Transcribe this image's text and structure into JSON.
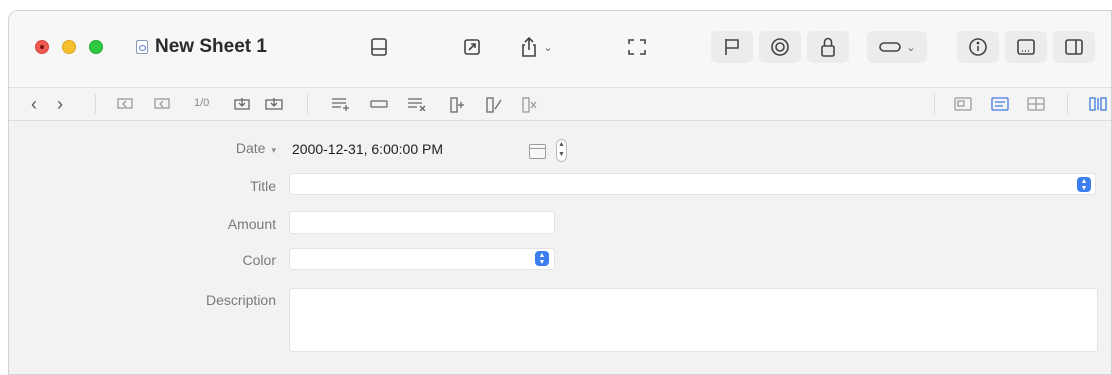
{
  "window": {
    "title": "New Sheet 1"
  },
  "titlebar_buttons": [
    {
      "name": "sidebar-toggle-icon"
    },
    {
      "name": "open-external-icon"
    },
    {
      "name": "share-icon"
    },
    {
      "name": "fullscreen-icon"
    },
    {
      "name": "flag-icon"
    },
    {
      "name": "target-icon"
    },
    {
      "name": "lock-icon"
    },
    {
      "name": "capsule-icon"
    },
    {
      "name": "info-icon"
    },
    {
      "name": "bottom-panel-icon"
    },
    {
      "name": "right-panel-icon"
    }
  ],
  "toolbar": {
    "back": "‹",
    "forward": "›",
    "record_count": "1/0"
  },
  "form": {
    "fields": [
      {
        "label": "Date",
        "value": "2000-12-31,  6:00:00 PM"
      },
      {
        "label": "Title",
        "value": ""
      },
      {
        "label": "Amount",
        "value": ""
      },
      {
        "label": "Color",
        "value": ""
      },
      {
        "label": "Description",
        "value": ""
      }
    ]
  },
  "colors": {
    "accent": "#3c7ef0",
    "close": "#ee5a52",
    "minimize": "#f5bf2f",
    "maximize": "#2fc841"
  }
}
